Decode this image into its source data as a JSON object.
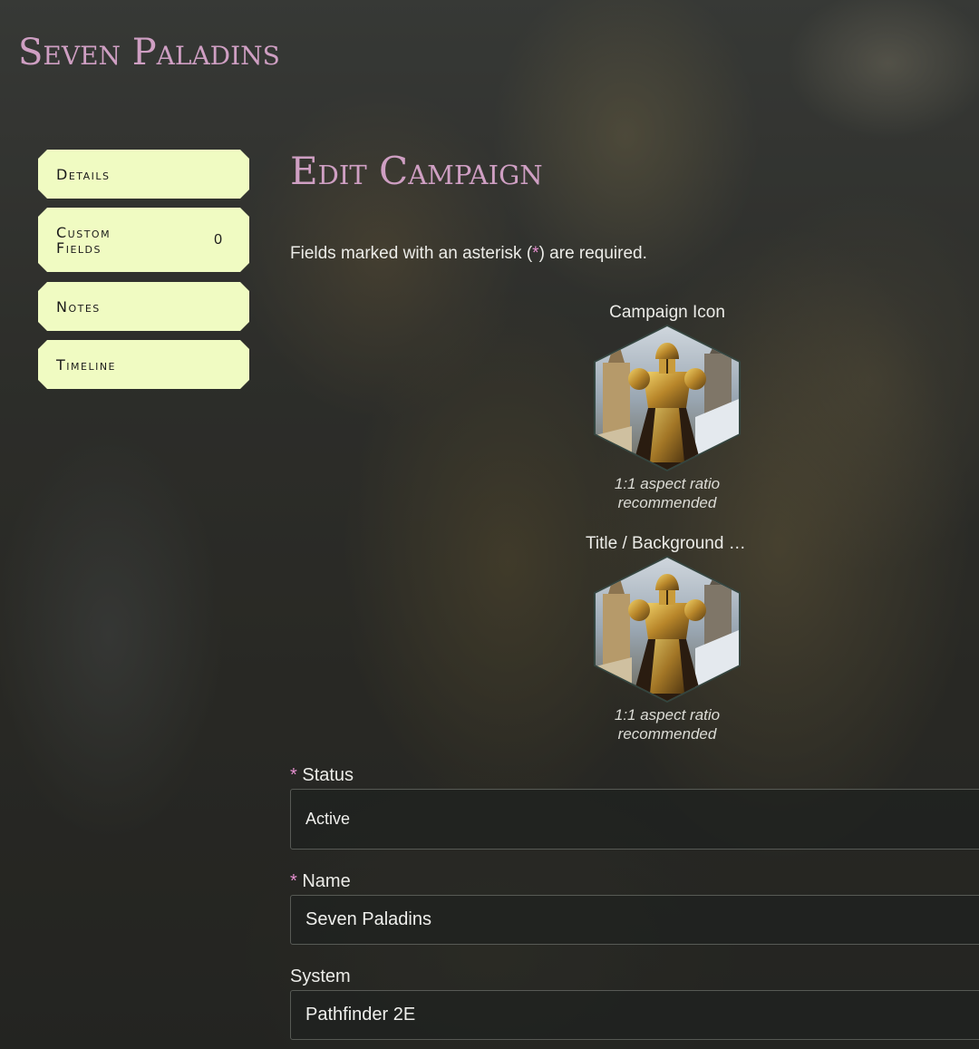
{
  "site": {
    "title": "Seven Paladins"
  },
  "sidebar": {
    "items": [
      {
        "label": "Details"
      },
      {
        "label": "Custom Fields",
        "count": "0"
      },
      {
        "label": "Notes"
      },
      {
        "label": "Timeline"
      }
    ]
  },
  "page": {
    "heading": "Edit Campaign",
    "required_note_before": "Fields marked with an asterisk (",
    "required_note_star": "*",
    "required_note_after": ") are required."
  },
  "images": {
    "icon": {
      "label": "Campaign Icon",
      "hint_line1": "1:1 aspect ratio",
      "hint_line2": "recommended"
    },
    "background": {
      "label": "Title / Background Image",
      "hint_line1": "1:1 aspect ratio",
      "hint_line2": "recommended"
    }
  },
  "form": {
    "required_marker": "*",
    "status": {
      "label": "Status",
      "value": "Active"
    },
    "name": {
      "label": "Name",
      "value": "Seven Paladins"
    },
    "system": {
      "label": "System",
      "value": "Pathfinder 2E"
    }
  },
  "colors": {
    "accent_pink": "#cf9fc3",
    "nav_bg": "#f0fbc2",
    "asterisk": "#e58fcf"
  }
}
